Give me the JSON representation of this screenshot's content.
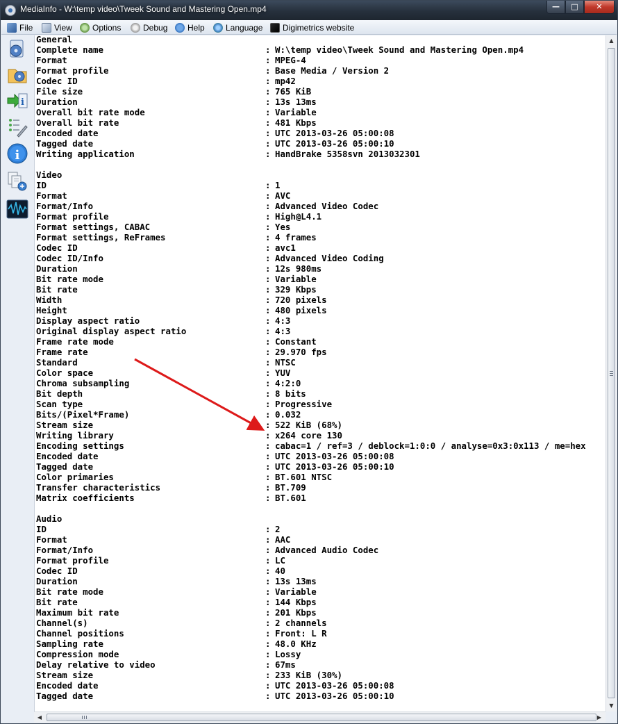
{
  "window": {
    "title": "MediaInfo - W:\\temp video\\Tweek Sound and Mastering Open.mp4",
    "buttons": {
      "minimize": "—",
      "maximize": "□",
      "close": "✕"
    }
  },
  "menu": [
    {
      "label": "File",
      "icon": "file-icon"
    },
    {
      "label": "View",
      "icon": "view-icon"
    },
    {
      "label": "Options",
      "icon": "options-icon"
    },
    {
      "label": "Debug",
      "icon": "debug-icon"
    },
    {
      "label": "Help",
      "icon": "help-icon"
    },
    {
      "label": "Language",
      "icon": "language-icon"
    },
    {
      "label": "Digimetrics website",
      "icon": "digimetrics-icon"
    }
  ],
  "sidebar_icons": [
    "open-file-icon",
    "open-folder-icon",
    "export-icon",
    "preferences-icon",
    "about-icon",
    "sheet-view-icon",
    "waveform-icon"
  ],
  "colors": {
    "arrow": "#dd1a1a",
    "title_bar": "#26303c",
    "menu_bar": "#e6ecf4"
  },
  "report": [
    {
      "key": "General",
      "value": null
    },
    {
      "key": "Complete name",
      "value": "W:\\temp video\\Tweek Sound and Mastering Open.mp4"
    },
    {
      "key": "Format",
      "value": "MPEG-4"
    },
    {
      "key": "Format profile",
      "value": "Base Media / Version 2"
    },
    {
      "key": "Codec ID",
      "value": "mp42"
    },
    {
      "key": "File size",
      "value": "765 KiB"
    },
    {
      "key": "Duration",
      "value": "13s 13ms"
    },
    {
      "key": "Overall bit rate mode",
      "value": "Variable"
    },
    {
      "key": "Overall bit rate",
      "value": "481 Kbps"
    },
    {
      "key": "Encoded date",
      "value": "UTC 2013-03-26 05:00:08"
    },
    {
      "key": "Tagged date",
      "value": "UTC 2013-03-26 05:00:10"
    },
    {
      "key": "Writing application",
      "value": "HandBrake 5358svn 2013032301"
    },
    {
      "key": "",
      "value": null
    },
    {
      "key": "Video",
      "value": null
    },
    {
      "key": "ID",
      "value": "1"
    },
    {
      "key": "Format",
      "value": "AVC"
    },
    {
      "key": "Format/Info",
      "value": "Advanced Video Codec"
    },
    {
      "key": "Format profile",
      "value": "High@L4.1"
    },
    {
      "key": "Format settings, CABAC",
      "value": "Yes"
    },
    {
      "key": "Format settings, ReFrames",
      "value": "4 frames"
    },
    {
      "key": "Codec ID",
      "value": "avc1"
    },
    {
      "key": "Codec ID/Info",
      "value": "Advanced Video Coding"
    },
    {
      "key": "Duration",
      "value": "12s 980ms"
    },
    {
      "key": "Bit rate mode",
      "value": "Variable"
    },
    {
      "key": "Bit rate",
      "value": "329 Kbps"
    },
    {
      "key": "Width",
      "value": "720 pixels"
    },
    {
      "key": "Height",
      "value": "480 pixels"
    },
    {
      "key": "Display aspect ratio",
      "value": "4:3"
    },
    {
      "key": "Original display aspect ratio",
      "value": "4:3"
    },
    {
      "key": "Frame rate mode",
      "value": "Constant"
    },
    {
      "key": "Frame rate",
      "value": "29.970 fps"
    },
    {
      "key": "Standard",
      "value": "NTSC"
    },
    {
      "key": "Color space",
      "value": "YUV"
    },
    {
      "key": "Chroma subsampling",
      "value": "4:2:0"
    },
    {
      "key": "Bit depth",
      "value": "8 bits"
    },
    {
      "key": "Scan type",
      "value": "Progressive"
    },
    {
      "key": "Bits/(Pixel*Frame)",
      "value": "0.032"
    },
    {
      "key": "Stream size",
      "value": "522 KiB (68%)"
    },
    {
      "key": "Writing library",
      "value": "x264 core 130"
    },
    {
      "key": "Encoding settings",
      "value": "cabac=1 / ref=3 / deblock=1:0:0 / analyse=0x3:0x113 / me=hex"
    },
    {
      "key": "Encoded date",
      "value": "UTC 2013-03-26 05:00:08"
    },
    {
      "key": "Tagged date",
      "value": "UTC 2013-03-26 05:00:10"
    },
    {
      "key": "Color primaries",
      "value": "BT.601 NTSC"
    },
    {
      "key": "Transfer characteristics",
      "value": "BT.709"
    },
    {
      "key": "Matrix coefficients",
      "value": "BT.601"
    },
    {
      "key": "",
      "value": null
    },
    {
      "key": "Audio",
      "value": null
    },
    {
      "key": "ID",
      "value": "2"
    },
    {
      "key": "Format",
      "value": "AAC"
    },
    {
      "key": "Format/Info",
      "value": "Advanced Audio Codec"
    },
    {
      "key": "Format profile",
      "value": "LC"
    },
    {
      "key": "Codec ID",
      "value": "40"
    },
    {
      "key": "Duration",
      "value": "13s 13ms"
    },
    {
      "key": "Bit rate mode",
      "value": "Variable"
    },
    {
      "key": "Bit rate",
      "value": "144 Kbps"
    },
    {
      "key": "Maximum bit rate",
      "value": "201 Kbps"
    },
    {
      "key": "Channel(s)",
      "value": "2 channels"
    },
    {
      "key": "Channel positions",
      "value": "Front: L R"
    },
    {
      "key": "Sampling rate",
      "value": "48.0 KHz"
    },
    {
      "key": "Compression mode",
      "value": "Lossy"
    },
    {
      "key": "Delay relative to video",
      "value": "67ms"
    },
    {
      "key": "Stream size",
      "value": "233 KiB (30%)"
    },
    {
      "key": "Encoded date",
      "value": "UTC 2013-03-26 05:00:08"
    },
    {
      "key": "Tagged date",
      "value": "UTC 2013-03-26 05:00:10"
    }
  ]
}
